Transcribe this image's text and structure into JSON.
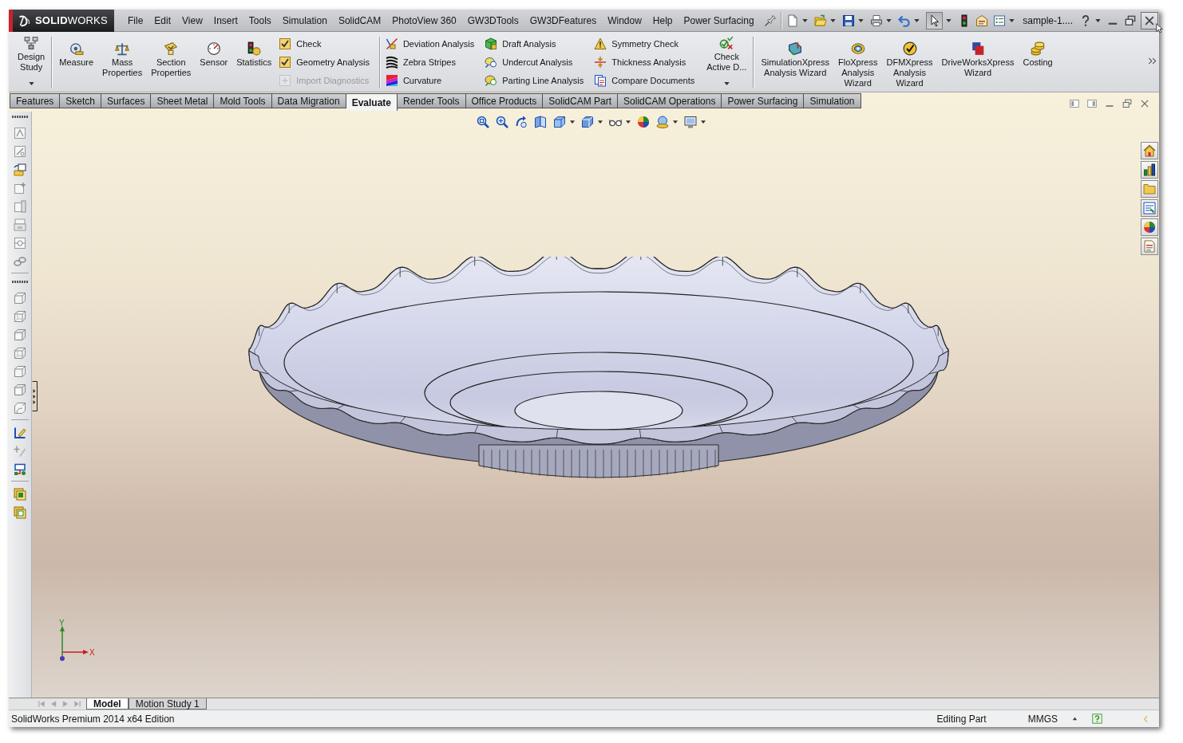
{
  "app": {
    "logo": "**SOLID**WORKS",
    "document_title": "sample-1....",
    "select_tool_active": true
  },
  "menu": [
    "File",
    "Edit",
    "View",
    "Insert",
    "Tools",
    "Simulation",
    "SolidCAM",
    "PhotoView 360",
    "GW3DTools",
    "GW3DFeatures",
    "Window",
    "Help",
    "Power Surfacing"
  ],
  "ribbon": [
    {
      "items": [
        {
          "kind": "large",
          "label": "Design\nStudy",
          "dropdown": true,
          "disabled": false
        }
      ]
    },
    {
      "items": [
        {
          "kind": "large",
          "label": "Measure",
          "dropdown": false,
          "disabled": false
        },
        {
          "kind": "large",
          "label": "Mass\nProperties",
          "dropdown": false,
          "disabled": false
        },
        {
          "kind": "large",
          "label": "Section\nProperties",
          "dropdown": false,
          "disabled": false
        },
        {
          "kind": "large",
          "label": "Sensor",
          "dropdown": false,
          "disabled": false
        },
        {
          "kind": "large",
          "label": "Statistics",
          "dropdown": false,
          "disabled": false
        },
        {
          "kind": "column",
          "items": [
            {
              "label": "Check",
              "disabled": false
            },
            {
              "label": "Geometry Analysis",
              "disabled": false
            },
            {
              "label": "Import Diagnostics",
              "disabled": true
            }
          ]
        }
      ]
    },
    {
      "items": [
        {
          "kind": "column",
          "items": [
            {
              "label": "Deviation Analysis",
              "disabled": false
            },
            {
              "label": "Zebra Stripes",
              "disabled": false
            },
            {
              "label": "Curvature",
              "disabled": false
            }
          ]
        },
        {
          "kind": "column",
          "items": [
            {
              "label": "Draft Analysis",
              "disabled": false
            },
            {
              "label": "Undercut Analysis",
              "disabled": false
            },
            {
              "label": "Parting Line Analysis",
              "disabled": false
            }
          ]
        },
        {
          "kind": "column",
          "items": [
            {
              "label": "Symmetry Check",
              "disabled": false
            },
            {
              "label": "Thickness Analysis",
              "disabled": false
            },
            {
              "label": "Compare Documents",
              "disabled": false
            }
          ]
        },
        {
          "kind": "large",
          "label": "Check\nActive D...",
          "dropdown": true,
          "disabled": false
        }
      ]
    },
    {
      "items": [
        {
          "kind": "large",
          "label": "SimulationXpress\nAnalysis Wizard",
          "dropdown": false,
          "disabled": false
        },
        {
          "kind": "large",
          "label": "FloXpress\nAnalysis\nWizard",
          "dropdown": false,
          "disabled": false
        },
        {
          "kind": "large",
          "label": "DFMXpress\nAnalysis\nWizard",
          "dropdown": false,
          "disabled": false
        },
        {
          "kind": "large",
          "label": "DriveWorksXpress\nWizard",
          "dropdown": false,
          "disabled": false
        },
        {
          "kind": "large",
          "label": "Costing",
          "dropdown": false,
          "disabled": false
        }
      ]
    }
  ],
  "tabs": [
    {
      "label": "Features",
      "selected": false
    },
    {
      "label": "Sketch",
      "selected": false
    },
    {
      "label": "Surfaces",
      "selected": false
    },
    {
      "label": "Sheet Metal",
      "selected": false
    },
    {
      "label": "Mold Tools",
      "selected": false
    },
    {
      "label": "Data Migration",
      "selected": false
    },
    {
      "label": "Evaluate",
      "selected": true
    },
    {
      "label": "Render Tools",
      "selected": false
    },
    {
      "label": "Office Products",
      "selected": false
    },
    {
      "label": "SolidCAM Part",
      "selected": false
    },
    {
      "label": "SolidCAM Operations",
      "selected": false
    },
    {
      "label": "Power Surfacing",
      "selected": false
    },
    {
      "label": "Simulation",
      "selected": false
    }
  ],
  "triad": {
    "y_label": "Y",
    "x_label": "X"
  },
  "bottom_tabs": [
    {
      "label": "Model",
      "selected": true
    },
    {
      "label": "Motion Study 1",
      "selected": false
    }
  ],
  "status_bar": {
    "edition": "SolidWorks Premium 2014 x64 Edition",
    "mode": "Editing Part",
    "units": "MMGS"
  }
}
